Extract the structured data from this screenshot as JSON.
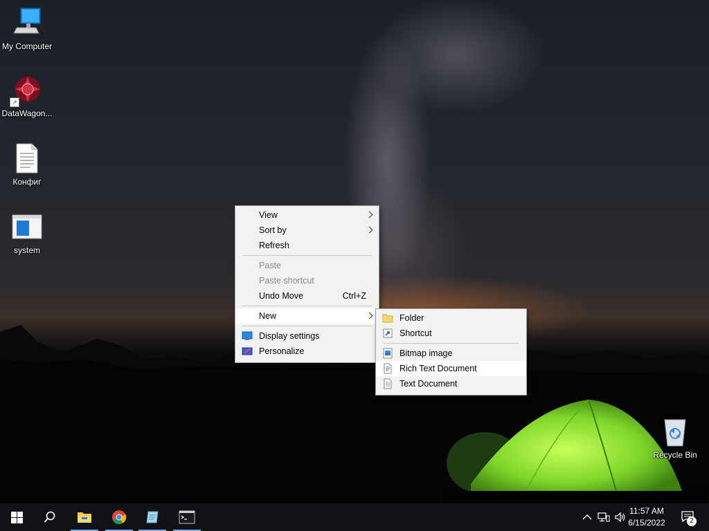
{
  "desktop": {
    "icons": [
      {
        "label": "My Computer",
        "icon": "computer-icon"
      },
      {
        "label": "DataWagon...",
        "icon": "datawagon-shortcut-icon"
      },
      {
        "label": "Конфиг",
        "icon": "text-file-icon"
      },
      {
        "label": "system",
        "icon": "window-icon"
      },
      {
        "label": "Recycle Bin",
        "icon": "recycle-bin-icon"
      }
    ]
  },
  "context_menu": {
    "view": "View",
    "sort_by": "Sort by",
    "refresh": "Refresh",
    "paste": "Paste",
    "paste_shortcut": "Paste shortcut",
    "undo_move": "Undo Move",
    "undo_move_shortcut": "Ctrl+Z",
    "new": "New",
    "display_settings": "Display settings",
    "personalize": "Personalize"
  },
  "new_submenu": {
    "folder": "Folder",
    "shortcut": "Shortcut",
    "bitmap_image": "Bitmap image",
    "rich_text_document": "Rich Text Document",
    "text_document": "Text Document"
  },
  "taskbar": {
    "pinned": [
      "start-icon",
      "search-icon",
      "file-explorer-icon",
      "chrome-icon",
      "notepad-icon",
      "terminal-icon"
    ],
    "clock_time": "11:57 AM",
    "clock_date": "6/15/2022",
    "notification_count": "2"
  },
  "colors": {
    "menu_bg": "#f2f2f2",
    "taskbar_bg": "#101114",
    "accent": "#0078d7"
  }
}
